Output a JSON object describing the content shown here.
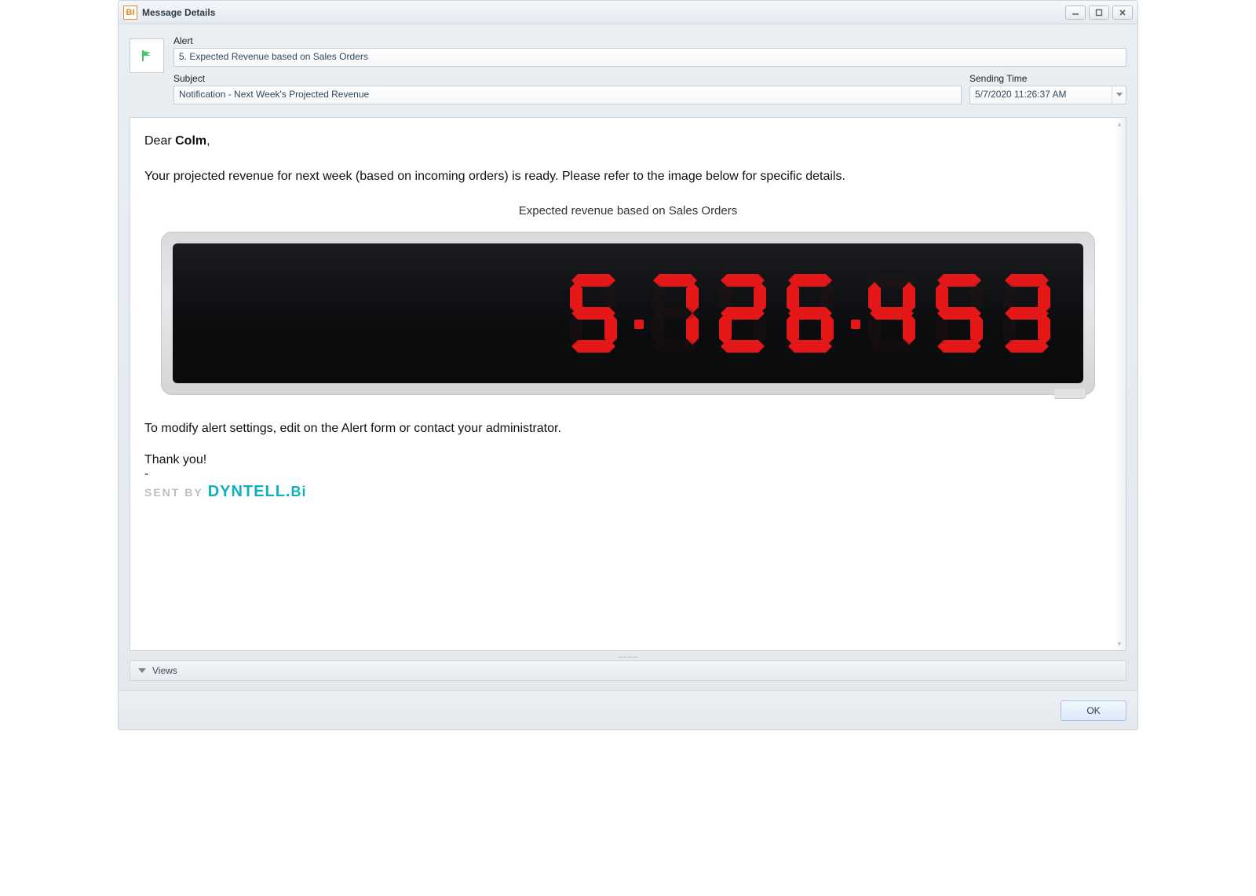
{
  "window": {
    "title": "Message Details",
    "app_icon_letters": "BI"
  },
  "header": {
    "alert_label": "Alert",
    "alert_value": "5. Expected Revenue based on Sales Orders",
    "subject_label": "Subject",
    "subject_value": "Notification - Next Week's Projected Revenue",
    "sending_time_label": "Sending Time",
    "sending_time_value": "5/7/2020 11:26:37 AM"
  },
  "message": {
    "greeting_prefix": "Dear ",
    "recipient_name": "Colm",
    "greeting_suffix": ",",
    "intro": "Your projected revenue for next week (based on incoming orders) is ready. Please refer to the image below for specific details.",
    "chart_title": "Expected revenue based on Sales Orders",
    "display_value": "5.726.453",
    "footer1": "To modify alert settings, edit on the Alert form or contact your administrator.",
    "footer2": "Thank you!",
    "dash": "-",
    "sent_by_label": "SENT BY",
    "brand_main": "DYNTELL",
    "brand_dot": ".",
    "brand_suffix": "Bi"
  },
  "views_bar": {
    "label": "Views"
  },
  "buttons": {
    "ok": "OK"
  },
  "chart_data": {
    "type": "table",
    "title": "Expected revenue based on Sales Orders",
    "series": [
      {
        "name": "Expected Revenue",
        "values": [
          5726453
        ]
      }
    ],
    "display_format": "5.726.453",
    "value": 5726453,
    "units": "currency (unspecified)"
  },
  "colors": {
    "accent": "#12b0bf",
    "digit_red": "#e41818",
    "window_bg": "#e7ebef"
  }
}
